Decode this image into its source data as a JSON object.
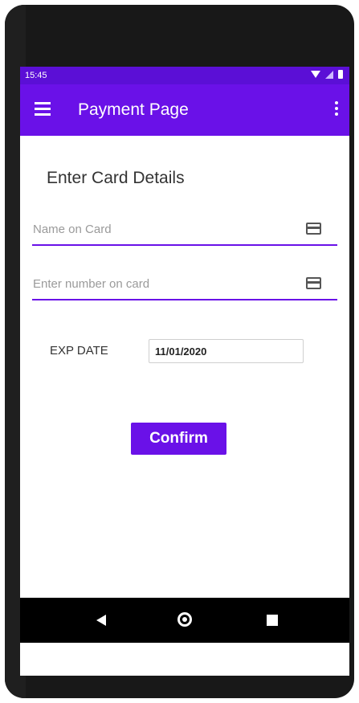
{
  "status_bar": {
    "time": "15:45"
  },
  "app_bar": {
    "title": "Payment Page"
  },
  "form": {
    "section_title": "Enter Card Details",
    "name_field": {
      "placeholder": "Name on Card",
      "value": ""
    },
    "number_field": {
      "placeholder": "Enter number on card",
      "value": ""
    },
    "exp_label": "EXP DATE",
    "exp_value": "11/01/2020",
    "confirm_label": "Confirm"
  },
  "colors": {
    "status_bar": "#5b0fd6",
    "primary": "#6a11e8",
    "text": "#333333"
  },
  "icons": {
    "menu": "hamburger-menu-icon",
    "overflow": "more-vert-icon",
    "card": "credit-card-icon",
    "nav_back": "back-triangle-icon",
    "nav_home": "home-circle-icon",
    "nav_recents": "recents-square-icon"
  }
}
